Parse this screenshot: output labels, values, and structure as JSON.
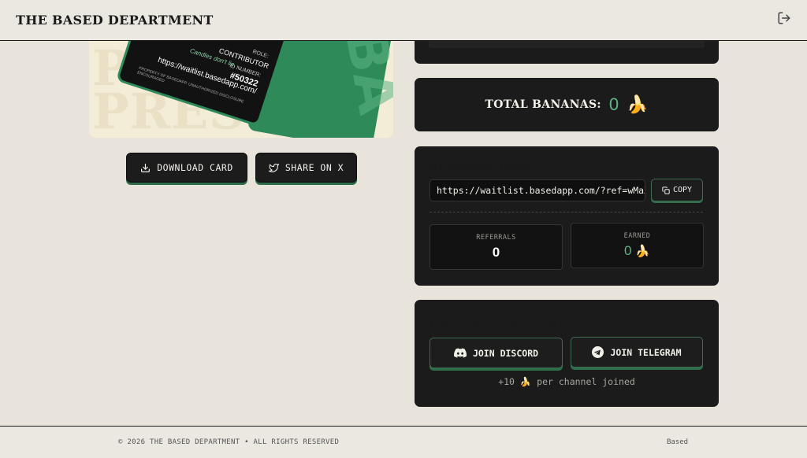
{
  "header": {
    "brand": "THE BASED DEPARTMENT",
    "logout_icon": "logout-icon"
  },
  "card": {
    "watermark_lines": [
      "PRESS",
      "PRESS"
    ],
    "role_label": "ROLE:",
    "role": "CONTRIBUTOR",
    "id_label": "ID NUMBER:",
    "id_number": "#50322",
    "tagline": "Candles don't lie.",
    "url": "https://waitlist.basedapp.com/",
    "property_note": "PROPERTY OF BASEDAPP. UNAUTHORIZED DISCLOSURE ENCOURAGED",
    "back_letters": "BA",
    "accent_color": "#2e8a58"
  },
  "actions": {
    "download_label": "DOWNLOAD CARD",
    "share_label": "SHARE ON X"
  },
  "bananas": {
    "label": "TOTAL BANANAS:",
    "value": "0",
    "emoji": "🍌"
  },
  "referral": {
    "title": "REFERRAL DESK",
    "link": "https://waitlist.basedapp.com/?ref=wMaXl3",
    "copy_label": "COPY",
    "referrals_label": "REFERRALS",
    "referrals_value": "0",
    "earned_label": "EARNED",
    "earned_value": "0",
    "earned_emoji": "🍌"
  },
  "community": {
    "title": "JOIN THE COMMUNITY",
    "discord_label": "JOIN DISCORD",
    "telegram_label": "JOIN TELEGRAM",
    "note_prefix": "+10",
    "note_emoji": "🍌",
    "note_suffix": "per channel joined"
  },
  "footer": {
    "copyright": "© 2026 THE BASED DEPARTMENT • ALL RIGHTS RESERVED",
    "brand": "Based"
  },
  "colors": {
    "accent_green": "#5fb587",
    "panel_bg": "#1b1b1b",
    "page_bg": "#e8e4dc"
  }
}
